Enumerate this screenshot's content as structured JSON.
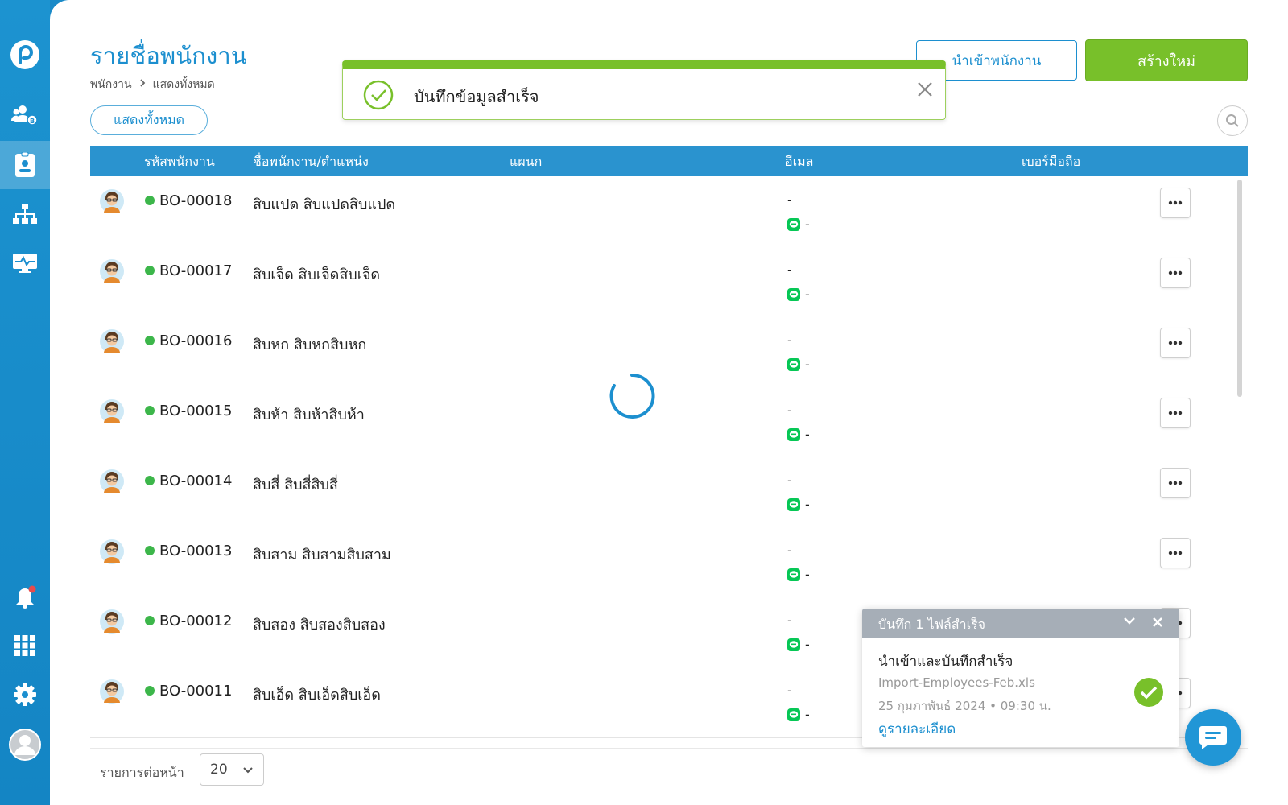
{
  "page": {
    "title": "รายชื่อพนักงาน",
    "breadcrumb": [
      "พนักงาน",
      "แสดงทั้งหมด"
    ],
    "filter_label": "แสดงทั้งหมด",
    "import_label": "นำเข้าพนักงาน",
    "create_label": "สร้างใหม่"
  },
  "toast": {
    "message": "บันทึกข้อมูลสำเร็จ"
  },
  "table": {
    "headers": {
      "code": "รหัสพนักงาน",
      "name": "ชื่อพนักงาน/ตำแหน่ง",
      "department": "แผนก",
      "email": "อีเมล",
      "phone": "เบอร์มือถือ"
    },
    "rows": [
      {
        "code": "BO-00018",
        "name": "สิบแปด สิบแปดสิบแปด",
        "email": "-",
        "line": "-"
      },
      {
        "code": "BO-00017",
        "name": "สิบเจ็ด สิบเจ็ดสิบเจ็ด",
        "email": "-",
        "line": "-"
      },
      {
        "code": "BO-00016",
        "name": "สิบหก สิบหกสิบหก",
        "email": "-",
        "line": "-"
      },
      {
        "code": "BO-00015",
        "name": "สิบห้า สิบห้าสิบห้า",
        "email": "-",
        "line": "-"
      },
      {
        "code": "BO-00014",
        "name": "สิบสี่ สิบสี่สิบสี่",
        "email": "-",
        "line": "-"
      },
      {
        "code": "BO-00013",
        "name": "สิบสาม สิบสามสิบสาม",
        "email": "-",
        "line": "-"
      },
      {
        "code": "BO-00012",
        "name": "สิบสอง สิบสองสิบสอง",
        "email": "-",
        "line": "-"
      },
      {
        "code": "BO-00011",
        "name": "สิบเอ็ด สิบเอ็ดสิบเอ็ด",
        "email": "-",
        "line": "-"
      }
    ]
  },
  "footer": {
    "per_page_label": "รายการต่อหน้า",
    "per_page_value": "20"
  },
  "upload": {
    "header": "บันทึก 1 ไฟล์สำเร็จ",
    "title": "นำเข้าและบันทึกสำเร็จ",
    "file": "Import-Employees-Feb.xls",
    "date": "25 กุมภาพันธ์ 2024 • 09:30 น.",
    "link": "ดูรายละเอียด"
  },
  "icons": {
    "sidebar": [
      "logo-icon",
      "user-group-icon",
      "employee-card-icon",
      "org-chart-icon",
      "monitor-icon",
      "bell-icon",
      "apps-grid-icon",
      "settings-icon",
      "profile-avatar-icon"
    ],
    "other": [
      "search-icon",
      "check-circle-icon",
      "close-icon",
      "more-icon",
      "line-icon",
      "chevron-down-icon",
      "chat-icon"
    ]
  },
  "colors": {
    "primary": "#1c8fcf",
    "success": "#78c02a",
    "status_active": "#3cb64a",
    "line_green": "#06c755"
  }
}
